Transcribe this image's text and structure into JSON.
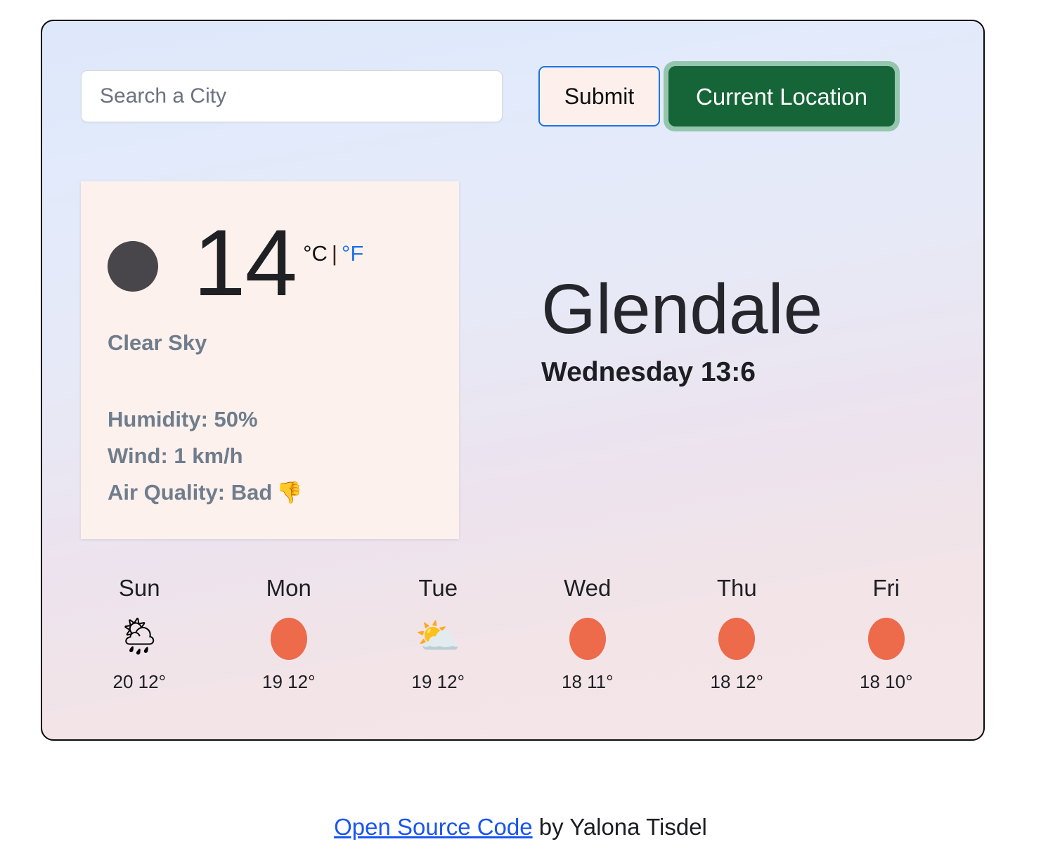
{
  "search": {
    "placeholder": "Search a City",
    "value": "",
    "submit_label": "Submit",
    "current_location_label": "Current Location"
  },
  "current": {
    "icon": "black-circle-icon",
    "temperature": "14",
    "unit_celsius": "°C",
    "unit_separator": "|",
    "unit_fahrenheit": "°F",
    "condition": "Clear Sky",
    "humidity": "Humidity: 50%",
    "wind": "Wind: 1 km/h",
    "air_quality": "Air Quality: Bad",
    "air_quality_icon": "👎"
  },
  "location": {
    "city": "Glendale",
    "datetime": "Wednesday 13:6"
  },
  "forecast": [
    {
      "day": "Sun",
      "icon": "sun-behind-rain-cloud-icon",
      "glyph": "🌦",
      "temps": "20 12°"
    },
    {
      "day": "Mon",
      "icon": "sun-icon",
      "glyph": "☀",
      "temps": "19 12°"
    },
    {
      "day": "Tue",
      "icon": "sun-behind-cloud-icon",
      "glyph": "⛅",
      "temps": "19 12°"
    },
    {
      "day": "Wed",
      "icon": "sun-icon",
      "glyph": "☀",
      "temps": "18 11°"
    },
    {
      "day": "Thu",
      "icon": "sun-icon",
      "glyph": "☀",
      "temps": "18 12°"
    },
    {
      "day": "Fri",
      "icon": "sun-icon",
      "glyph": "☀",
      "temps": "18 10°"
    }
  ],
  "footer": {
    "link_label": "Open Source Code",
    "credit": " by Yalona Tisdel"
  },
  "colors": {
    "accent_green": "#166538",
    "accent_green_ring": "#94c6ae",
    "link_blue": "#1a73e8",
    "footer_link_blue": "#1a55f0",
    "card_bg": "#fdf1ed",
    "muted_text": "#6f7d8c",
    "sun_orange": "#ed6a4a",
    "icon_dark": "#48464a"
  }
}
